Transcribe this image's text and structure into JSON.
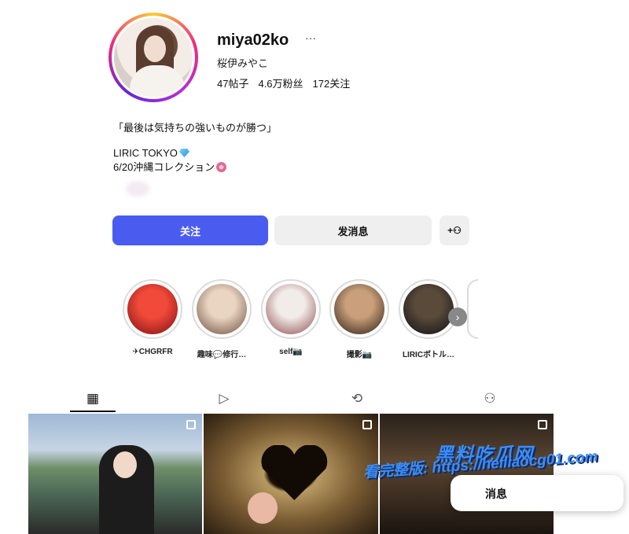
{
  "profile": {
    "username": "miya02ko",
    "more": "···",
    "full_name": "桜伊みやこ",
    "stats": {
      "posts": "47帖子",
      "followers": "4.6万粉丝",
      "following": "172关注"
    },
    "bio": {
      "quote": "「最後は気持ちの強いものが勝つ」",
      "brand": "LIRIC TOKYO",
      "event": "6/20沖縄コレクション"
    }
  },
  "actions": {
    "follow": "关注",
    "message": "发消息",
    "add_user": "+⚇"
  },
  "highlights": [
    {
      "label": "✈CHGRFR",
      "colors": [
        "#f24a3a",
        "#7a0f0f"
      ]
    },
    {
      "label": "趣味💬修行…",
      "colors": [
        "#e9d5c2",
        "#6b4a3a"
      ]
    },
    {
      "label": "self📷",
      "colors": [
        "#f2ece8",
        "#8a4a4a"
      ]
    },
    {
      "label": "撮影📷",
      "colors": [
        "#c9a07a",
        "#2a1a12"
      ]
    },
    {
      "label": "LIRICボトル…",
      "colors": [
        "#5a4a3a",
        "#0d0d14"
      ]
    }
  ],
  "tabs": [
    {
      "icon": "grid-icon",
      "glyph": "▦"
    },
    {
      "icon": "reels-icon",
      "glyph": "▷"
    },
    {
      "icon": "repost-icon",
      "glyph": "⟲"
    },
    {
      "icon": "tagged-icon",
      "glyph": "⚇"
    }
  ],
  "watermark": {
    "title": "黑料吃瓜网",
    "url": "看完整版: https://heiliaocg01.com"
  },
  "overlay": {
    "label": "消息"
  },
  "colors": {
    "accent": "#4a5cf0",
    "button_bg": "#efefef",
    "watermark": "#3b8df7"
  }
}
